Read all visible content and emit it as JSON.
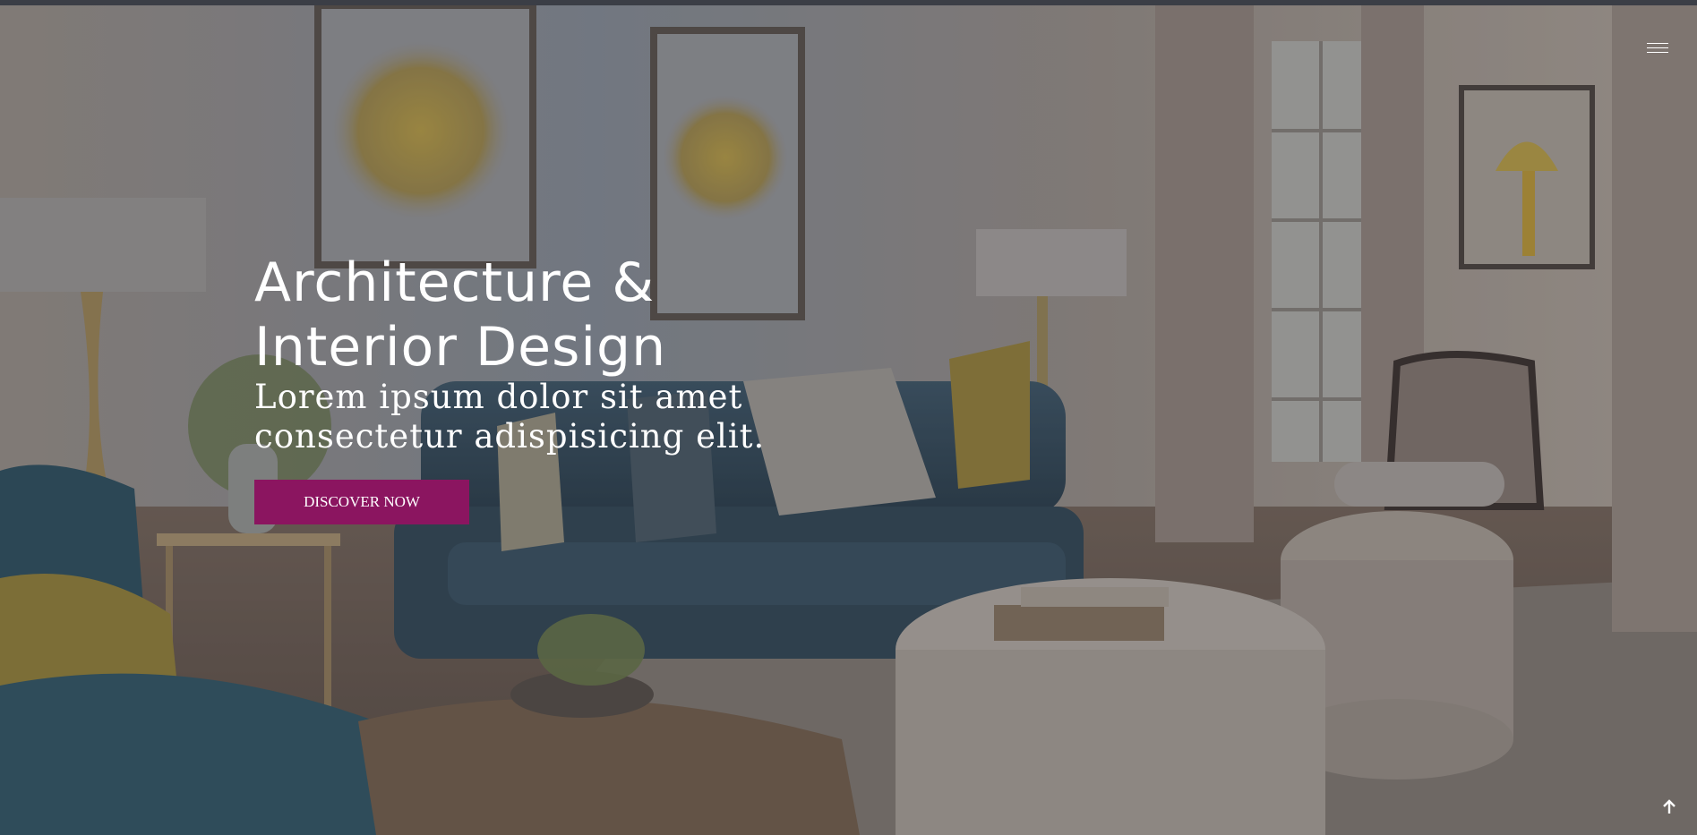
{
  "hero": {
    "title_line1": "Architecture &",
    "title_line2": "Interior Design",
    "subtitle_line1": "Lorem ipsum dolor sit amet",
    "subtitle_line2": "consectetur adispisicing elit.",
    "cta_label": "DISCOVER NOW",
    "background_image": "living-room-photo"
  },
  "nav": {
    "menu_icon": "hamburger-menu-icon"
  },
  "scroll_top": {
    "icon": "arrow-up-icon"
  },
  "colors": {
    "accent": "#8b1560",
    "text": "#ffffff",
    "top_strip": "#3b3e46"
  }
}
